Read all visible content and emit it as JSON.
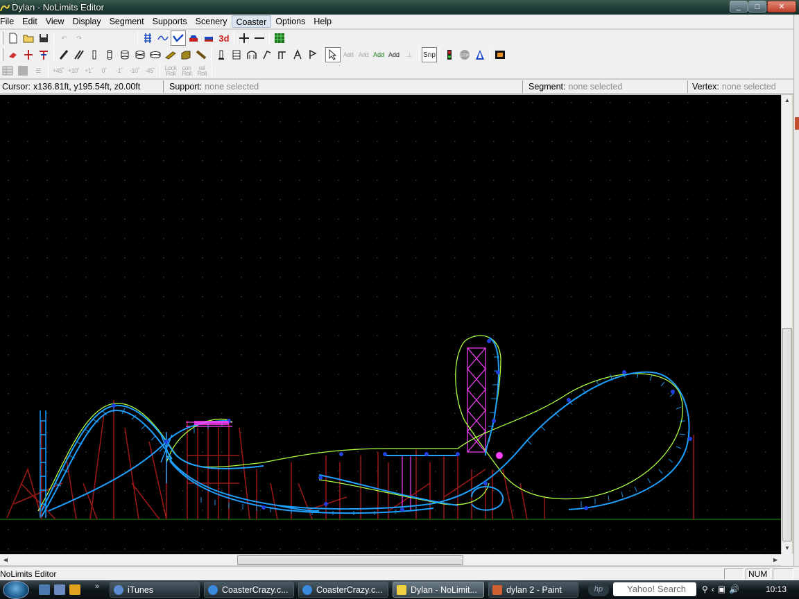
{
  "window": {
    "title": "Dylan - NoLimits Editor",
    "controls": [
      "_",
      "□",
      "✕"
    ]
  },
  "menu": [
    "File",
    "Edit",
    "View",
    "Display",
    "Segment",
    "Supports",
    "Scenery",
    "Coaster",
    "Options",
    "Help"
  ],
  "menu_active": "Coaster",
  "toolbar3": {
    "roll_plus45": "+45˚",
    "roll_plus10": "+10˚",
    "roll_plus1": "+1˚",
    "roll_zero": "0˚",
    "roll_minus1": "-1˚",
    "roll_minus10": "-10˚",
    "roll_minus45": "-45˚",
    "lock_roll": "Lock Roll",
    "con_roll": "con Roll",
    "rel_roll": "rel Roll"
  },
  "toolbar2": {
    "snap": "Snp",
    "add1": "Add",
    "add2": "Add",
    "add3": "Add",
    "add4": "Add",
    "stop": "STOP"
  },
  "toolbar1": {
    "three_d": "3d"
  },
  "info": {
    "cursor_label": "Cursor:",
    "cursor_value": "x136.81ft, y195.54ft, z0.00ft",
    "support_label": "Support:",
    "support_value": "none selected",
    "segment_label": "Segment:",
    "segment_value": "none selected",
    "vertex_label": "Vertex:",
    "vertex_value": "none selected"
  },
  "status": {
    "text": "NoLimits Editor",
    "num": "NUM"
  },
  "taskbar": {
    "items": [
      {
        "label": "iTunes",
        "icon": "itunes-icon",
        "active": false
      },
      {
        "label": "CoasterCrazy.c...",
        "icon": "ie-icon",
        "active": false
      },
      {
        "label": "CoasterCrazy.c...",
        "icon": "ie-icon",
        "active": false
      },
      {
        "label": "Dylan - NoLimit...",
        "icon": "nolimits-icon",
        "active": true
      },
      {
        "label": "dylan 2 - Paint",
        "icon": "paint-icon",
        "active": false
      }
    ],
    "hp": "hp",
    "search": "Yahoo! Search",
    "clock": "10:13"
  },
  "colors": {
    "track_blue": "#1ea0ff",
    "track_green": "#b0ff40",
    "support_red": "#b01818",
    "magenta": "#ff40ff",
    "ground": "#18a018",
    "grid_dot": "#3a3a3a"
  }
}
